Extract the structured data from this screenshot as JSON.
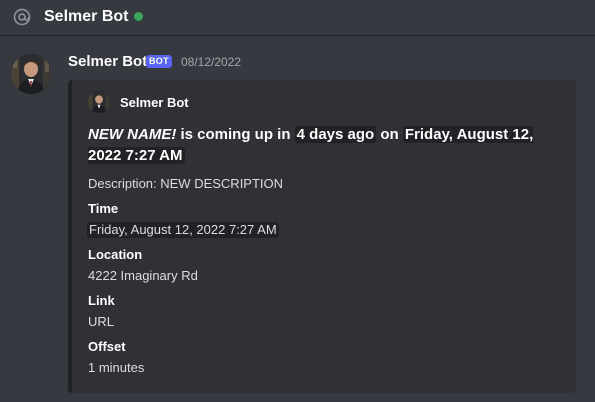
{
  "header": {
    "channel_name": "Selmer Bot",
    "status_color": "#3ba55d",
    "icon": "at-icon"
  },
  "message": {
    "author": "Selmer Bot",
    "bot_tag": "BOT",
    "timestamp": "08/12/2022",
    "avatar": "avatar"
  },
  "embed": {
    "author": "Selmer Bot",
    "title_part1": "NEW NAME!",
    "title_part2": " is coming up in ",
    "title_code1": "4 days ago",
    "title_part3": " on ",
    "title_code2": "Friday, August 12, 2022 7:27 AM",
    "description": "Description: NEW DESCRIPTION",
    "fields": [
      {
        "name": "Time",
        "value": "Friday, August 12, 2022 7:27 AM"
      },
      {
        "name": "Location",
        "value": "4222 Imaginary Rd"
      },
      {
        "name": "Link",
        "value": "URL"
      },
      {
        "name": "Offset",
        "value": "1 minutes"
      }
    ]
  }
}
